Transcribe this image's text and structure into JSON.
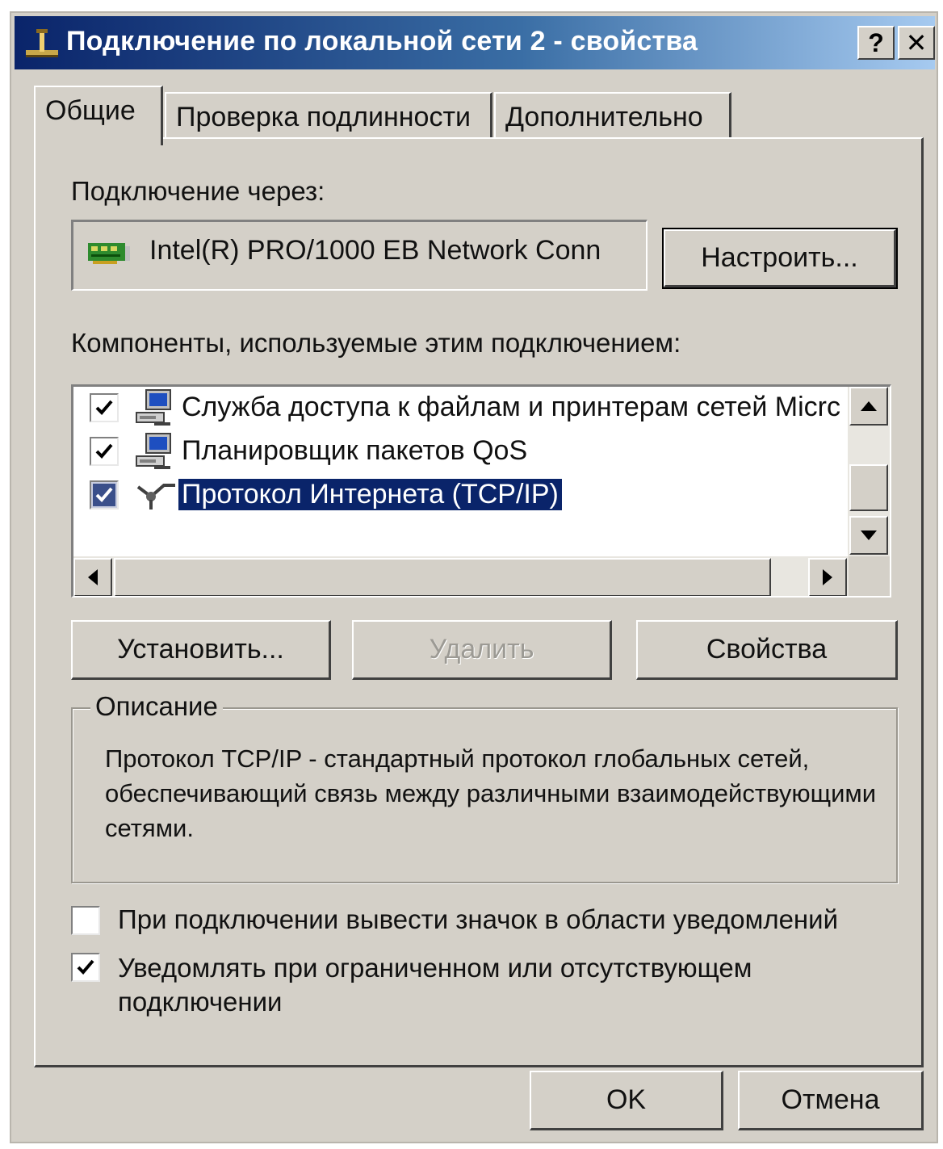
{
  "window": {
    "title": "Подключение по локальной сети 2 - свойства",
    "help_button": "?",
    "close_button": "✕"
  },
  "tabs": [
    {
      "label": "Общие",
      "active": true
    },
    {
      "label": "Проверка подлинности",
      "active": false
    },
    {
      "label": "Дополнительно",
      "active": false
    }
  ],
  "connect_via": {
    "label": "Подключение через:",
    "adapter_name": "Intel(R) PRO/1000 EB Network Conn",
    "configure_button": "Настроить..."
  },
  "components": {
    "label": "Компоненты, используемые этим подключением:",
    "items": [
      {
        "label": "Служба доступа к файлам и принтерам сетей Micrс",
        "checked": true,
        "selected": false,
        "icon": "network-service-icon"
      },
      {
        "label": "Планировщик пакетов QoS",
        "checked": true,
        "selected": false,
        "icon": "network-service-icon"
      },
      {
        "label": "Протокол Интернета (TCP/IP)",
        "checked": true,
        "selected": true,
        "icon": "protocol-icon"
      }
    ]
  },
  "buttons": {
    "install": "Установить...",
    "uninstall": "Удалить",
    "properties": "Свойства"
  },
  "description": {
    "legend": "Описание",
    "text": "Протокол TCP/IP - стандартный протокол глобальных сетей, обеспечивающий связь между различными взаимодействующими сетями."
  },
  "options": [
    {
      "label": "При подключении вывести значок в области уведомлений",
      "checked": false
    },
    {
      "label": "Уведомлять при ограниченном или отсутствующем подключении",
      "checked": true
    }
  ],
  "footer": {
    "ok": "OK",
    "cancel": "Отмена"
  },
  "colors": {
    "titlebar_start": "#0a246a",
    "titlebar_end": "#a6caf0",
    "dialog_face": "#d4d0c8",
    "selection": "#0a246a"
  }
}
